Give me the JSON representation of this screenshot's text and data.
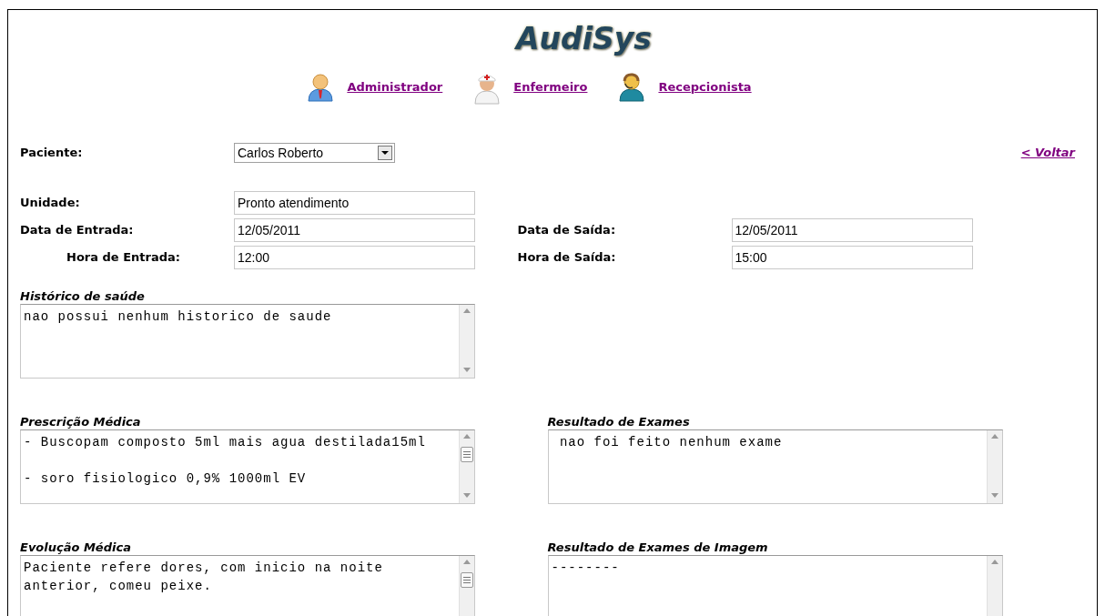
{
  "logo": "AudiSys",
  "nav": [
    {
      "label": "Administrador",
      "kind": "admin"
    },
    {
      "label": "Enfermeiro",
      "kind": "nurse"
    },
    {
      "label": "Recepcionista",
      "kind": "receptionist"
    }
  ],
  "patient": {
    "label": "Paciente:",
    "value": "Carlos Roberto"
  },
  "back_link": "< Voltar",
  "field_rows": [
    {
      "left": {
        "label": "Unidade:",
        "value": "Pronto atendimento",
        "kind": "plain"
      }
    },
    {
      "left": {
        "label": "Data de Entrada:",
        "value": "12/05/2011",
        "kind": "plain"
      },
      "right": {
        "label": "Data de Saída:",
        "value": "12/05/2011",
        "kind": "plain"
      }
    },
    {
      "left": {
        "label": "Hora de Entrada:",
        "value": "12:00",
        "kind": "indented"
      },
      "right": {
        "label": "Hora de Saída:",
        "value": "15:00",
        "kind": "plain"
      }
    }
  ],
  "note_rows": [
    {
      "left": {
        "label": "Histórico de saúde",
        "text": "nao possui nenhum historico de saude",
        "kind": "short"
      }
    },
    {
      "left": {
        "label": "Prescrição Médica",
        "text": "- Buscopam composto 5ml mais agua destilada15ml\n\n- soro fisiologico 0,9% 1000ml EV",
        "kind": "long"
      },
      "right": {
        "label": "Resultado de Exames",
        "text": " nao foi feito nenhum exame",
        "kind": "short"
      }
    },
    {
      "left": {
        "label": "Evolução Médica",
        "text": "Paciente refere dores, com inicio na noite anterior, comeu peixe.",
        "kind": "long"
      },
      "right": {
        "label": "Resultado de Exames de Imagem",
        "text": "--------",
        "kind": "short"
      }
    }
  ]
}
